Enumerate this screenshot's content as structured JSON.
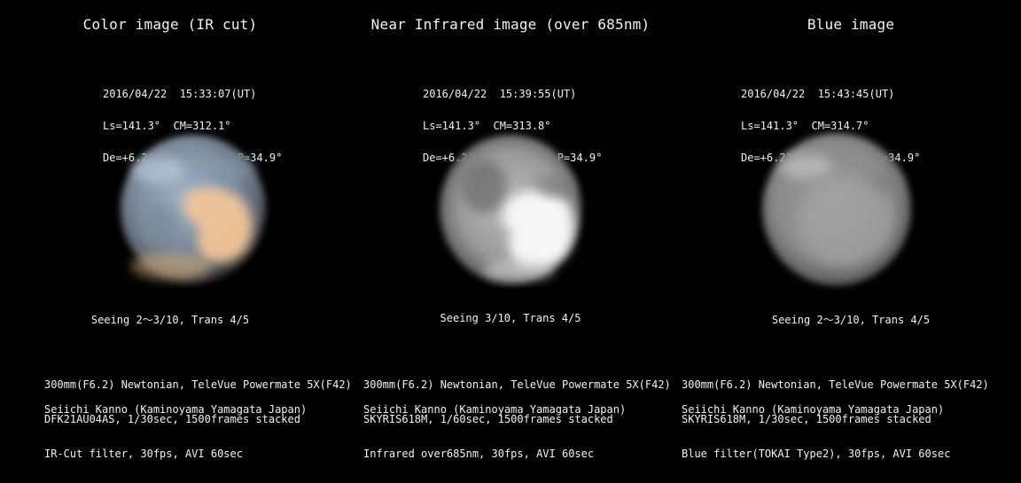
{
  "panels": [
    {
      "title": "Color image (IR cut)",
      "meta": {
        "line1": "2016/04/22  15:33:07(UT)",
        "line2": "Ls=141.3°  CM=312.1°",
        "line3": "De=+6.2°  Dia=14.9″  P=34.9°"
      },
      "seeing": "Seeing 2～3/10, Trans 4/5",
      "equipment": {
        "line1": "300mm(F6.2) Newtonian, TeleVue Powermate 5X(F42)",
        "line2": "DFK21AU04AS, 1/30sec, 1500frames stacked",
        "line3": "IR-Cut filter, 30fps, AVI 60sec"
      },
      "credit": "Seiichi Kanno (Kaminoyama Yamagata Japan)"
    },
    {
      "title": "Near Infrared image (over 685nm)",
      "meta": {
        "line1": "2016/04/22  15:39:55(UT)",
        "line2": "Ls=141.3°  CM=313.8°",
        "line3": "De=+6.2°  Dia=14.9″  P=34.9°"
      },
      "seeing": "Seeing 3/10, Trans 4/5",
      "equipment": {
        "line1": "300mm(F6.2) Newtonian, TeleVue Powermate 5X(F42)",
        "line2": "SKYRIS618M, 1/60sec, 1500frames stacked",
        "line3": "Infrared over685nm, 30fps, AVI 60sec"
      },
      "credit": "Seiichi Kanno (Kaminoyama Yamagata Japan)"
    },
    {
      "title": "Blue image",
      "meta": {
        "line1": "2016/04/22  15:43:45(UT)",
        "line2": "Ls=141.3°  CM=314.7°",
        "line3": "De=+6.2°  Dia=14.9″  P=34.9°"
      },
      "seeing": "Seeing 2～3/10, Trans 4/5",
      "equipment": {
        "line1": "300mm(F6.2) Newtonian, TeleVue Powermate 5X(F42)",
        "line2": "SKYRIS618M, 1/30sec, 1500frames stacked",
        "line3": "Blue filter(TOKAI Type2), 30fps, AVI 60sec"
      },
      "credit": "Seiichi Kanno (Kaminoyama Yamagata Japan)"
    }
  ],
  "colors": {
    "background": "#000000",
    "text": "#f2f2f2",
    "color_disk_blue": "#8ea3b8",
    "color_disk_orange": "#f0c095",
    "ir_disk_bright": "#f4f4f4",
    "ir_disk_dark": "#6e6e6e",
    "blue_disk": "#9a9a9a"
  }
}
